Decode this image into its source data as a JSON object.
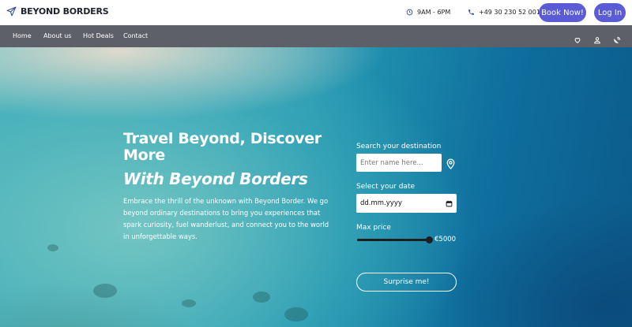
{
  "brand": {
    "name": "BEYOND BORDERS",
    "icon": "paper-plane-icon"
  },
  "header": {
    "hours": "9AM - 6PM",
    "phone": "+49 30 230 52 001",
    "book_label": "Book Now!",
    "login_label": "Log In",
    "accent_color": "#5b5bd6"
  },
  "nav": {
    "items": [
      "Home",
      "About us",
      "Hot Deals",
      "Contact"
    ],
    "icons": [
      "heart-icon",
      "user-icon",
      "satellite-dish-icon"
    ]
  },
  "hero": {
    "title": "Travel Beyond, Discover More",
    "subtitle": "With Beyond Borders",
    "text": "Embrace the thrill of the unknown with Beyond Border. We go beyond ordinary destinations to bring you experiences that spark curiosity, fuel wanderlust, and connect you to the world in unforgettable ways."
  },
  "search": {
    "destination_label": "Search your destination",
    "destination_placeholder": "Enter name here...",
    "date_label": "Select your date",
    "date_placeholder": "dd.mm.yyyy",
    "price_label": "Max price",
    "price_value": "€5000",
    "price_fraction": 1.0,
    "surprise_label": "Surprise me!"
  }
}
